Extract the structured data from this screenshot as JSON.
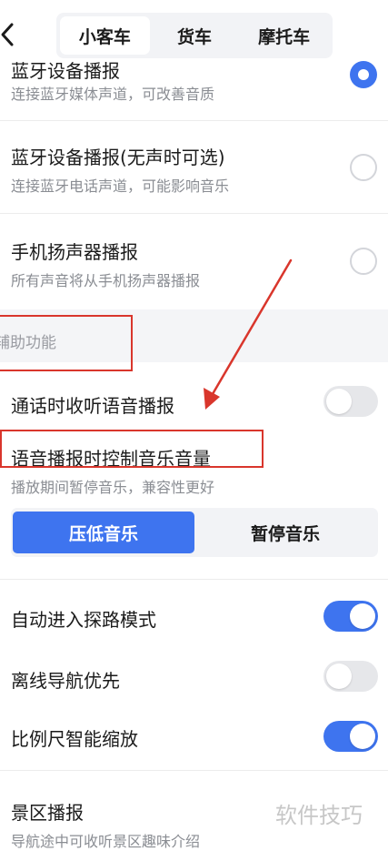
{
  "header": {
    "tabs": [
      {
        "label": "小客车",
        "active": true
      },
      {
        "label": "货车",
        "active": false
      },
      {
        "label": "摩托车",
        "active": false
      }
    ]
  },
  "playback_options": [
    {
      "title": "蓝牙设备播报",
      "subtitle": "连接蓝牙媒体声道，可改善音质",
      "selected": true
    },
    {
      "title": "蓝牙设备播报(无声时可选)",
      "subtitle": "连接蓝牙电话声道，可能影响音乐",
      "selected": false
    },
    {
      "title": "手机扬声器播报",
      "subtitle": "所有声音将从手机扬声器播报",
      "selected": false
    }
  ],
  "section": {
    "label": "辅助功能"
  },
  "call_voice": {
    "title": "通话时收听语音播报",
    "enabled": false
  },
  "music_control": {
    "title": "语音播报时控制音乐音量",
    "subtitle": "播放期间暂停音乐，兼容性更好",
    "options": [
      "压低音乐",
      "暂停音乐"
    ],
    "selected": "压低音乐"
  },
  "toggles": [
    {
      "title": "自动进入探路模式",
      "enabled": true
    },
    {
      "title": "离线导航优先",
      "enabled": false
    },
    {
      "title": "比例尺智能缩放",
      "enabled": true
    }
  ],
  "scenic": {
    "title": "景区播报",
    "subtitle": "导航途中可收听景区趣味介绍"
  },
  "watermark": "软件技巧",
  "colors": {
    "accent": "#3e74ef",
    "annotation": "#d9362c"
  }
}
